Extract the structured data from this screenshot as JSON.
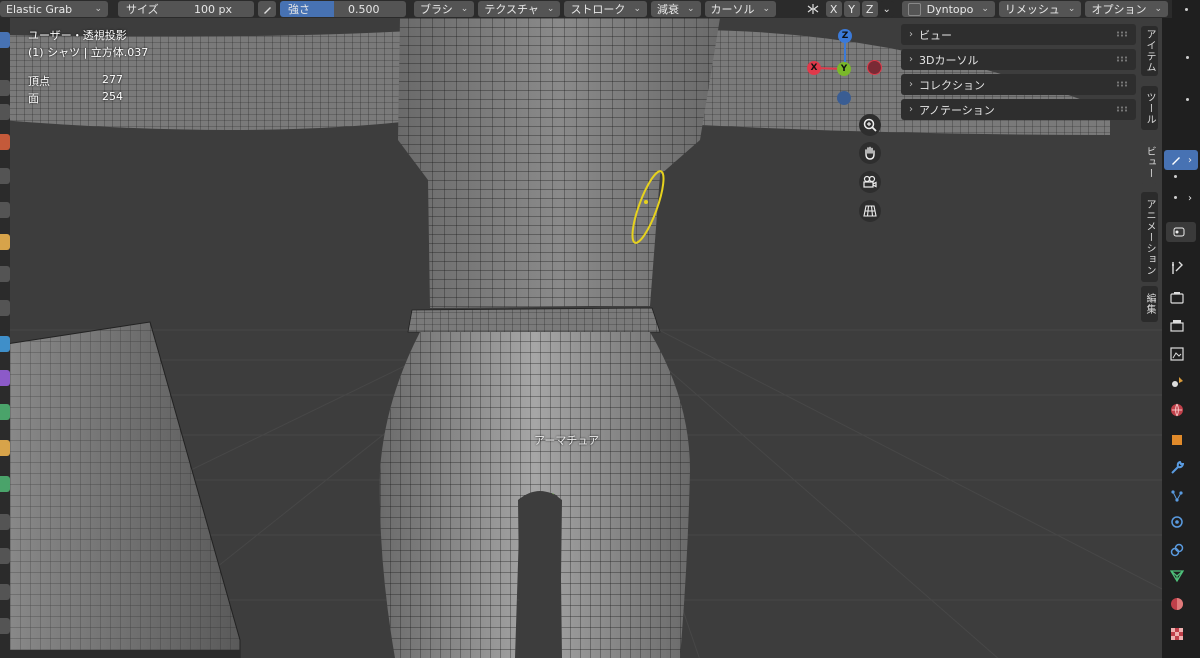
{
  "header": {
    "brush_name": "Elastic Grab",
    "size_label": "サイズ",
    "size_value": "100 px",
    "strength_label": "強さ",
    "strength_value": "0.500",
    "menus": [
      "ブラシ",
      "テクスチャ",
      "ストローク",
      "減衰",
      "カーソル"
    ],
    "axis_x": "X",
    "axis_y": "Y",
    "axis_z": "Z",
    "dyntopo": "Dyntopo",
    "remesh": "リメッシュ",
    "options": "オプション"
  },
  "overlay": {
    "view_name": "ユーザー・透視投影",
    "object_name": "(1) シャツ | 立方体.037",
    "stat_vertex_label": "頂点",
    "stat_vertex_value": "277",
    "stat_face_label": "面",
    "stat_face_value": "254",
    "armature_label": "アーマチュア"
  },
  "gizmo": {
    "z": "Z",
    "x": "X",
    "y": "Y",
    "colors": {
      "x": "#e0394a",
      "y": "#7ab82a",
      "z": "#3b7ad8",
      "neg": "#3a5d93"
    }
  },
  "npanel": {
    "sections": [
      "ビュー",
      "3Dカーソル",
      "コレクション",
      "アノテーション"
    ]
  },
  "vtabs": [
    "アイテム",
    "ツール",
    "ビュー",
    "アニメーション",
    "編集"
  ],
  "icons": {
    "zoom": "zoom-icon",
    "hand": "pan-hand-icon",
    "camera": "camera-icon",
    "grid": "ortho-grid-icon"
  },
  "colors": {
    "accent": "#4772b3",
    "brush_cursor": "#e6d21e",
    "viewport_bg": "#3d3d3d",
    "header_bg": "#2b2b2b"
  }
}
